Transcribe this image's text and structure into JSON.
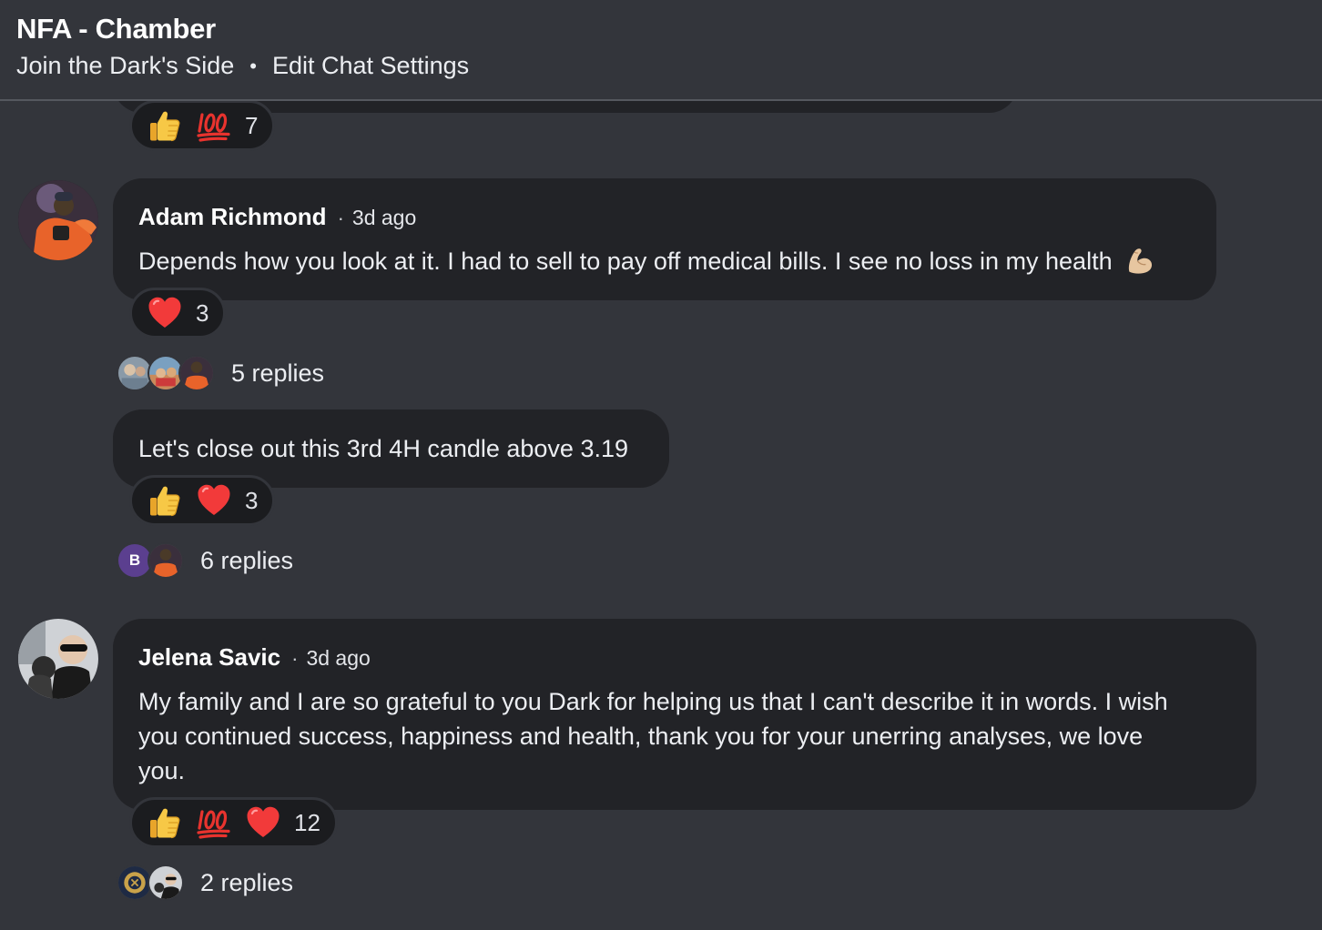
{
  "header": {
    "title": "NFA - Chamber",
    "join_link": "Join the Dark's Side",
    "separator": "•",
    "edit_link": "Edit Chat Settings"
  },
  "top_reactions": {
    "count": "7",
    "emojis": [
      "thumbs-up",
      "hundred-points"
    ]
  },
  "messages": [
    {
      "author": "Adam Richmond",
      "time": "3d ago",
      "text": "Depends how you look at it. I had to sell to pay off medical bills. I see no loss in my health",
      "trailing_emoji": "flexed-biceps",
      "reactions": {
        "emojis": [
          "red-heart"
        ],
        "count": "3"
      },
      "replies_label": "5 replies"
    },
    {
      "text": "Let's close out this 3rd 4H candle above 3.19",
      "reactions": {
        "emojis": [
          "thumbs-up",
          "red-heart"
        ],
        "count": "3"
      },
      "replies_label": "6 replies",
      "reply_initial": "B"
    },
    {
      "author": "Jelena Savic",
      "time": "3d ago",
      "text_lines": [
        "My family and I are so grateful to you Dark for helping us that I can't describe it in words. I wish",
        "you continued success, happiness and health, thank you for your unerring analyses, we love",
        "you."
      ],
      "reactions": {
        "emojis": [
          "thumbs-up",
          "hundred-points",
          "red-heart"
        ],
        "count": "12"
      },
      "replies_label": "2 replies"
    }
  ],
  "colors": {
    "background": "#33353b",
    "bubble": "#222327",
    "reaction_pill": "#1b1c1f",
    "text": "#eceef2",
    "purple_avatar": "#5b3f8f"
  }
}
